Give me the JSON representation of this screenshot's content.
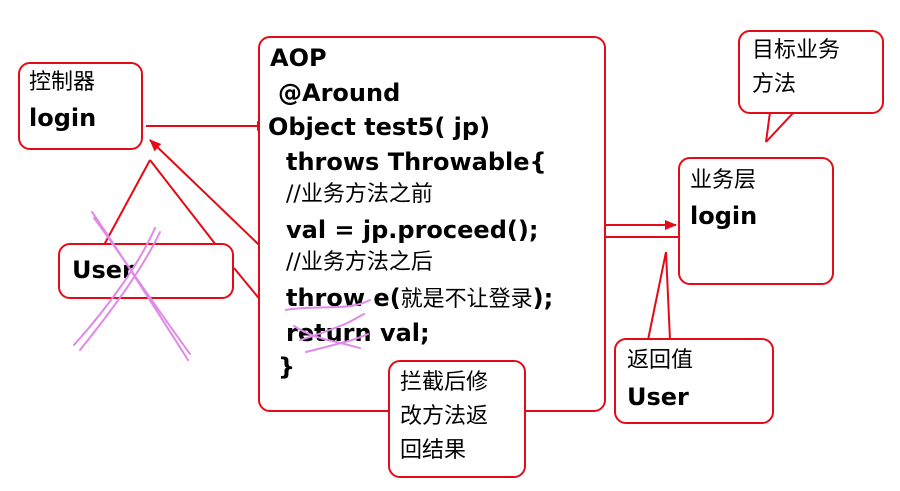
{
  "controller": {
    "title": "控制器",
    "method": "login"
  },
  "user_callout": {
    "text": "User"
  },
  "aop_code": {
    "header": "AOP",
    "annotation": "@Around",
    "signature": "Object test5( jp)",
    "throws_line": "throws Throwable{",
    "comment_before": "//业务方法之前",
    "proceed_line": "val = jp.proceed();",
    "comment_after": "//业务方法之后",
    "throw_line_code": "throw e(",
    "throw_line_note": "就是不让登录",
    "throw_line_end": ");",
    "return_line": "return val;",
    "close_brace": "}"
  },
  "target_callout": {
    "line1": "目标业务",
    "line2": "方法"
  },
  "service": {
    "title": "业务层",
    "method": "login"
  },
  "return_callout": {
    "title": "返回值",
    "value": "User"
  },
  "intercept_callout": {
    "line1": "拦截后修",
    "line2": "改方法返",
    "line3": "回结果"
  },
  "colors": {
    "border": "#e30b17",
    "arrow": "#e30b17",
    "strike": "#e08ae8",
    "text": "#000000"
  }
}
